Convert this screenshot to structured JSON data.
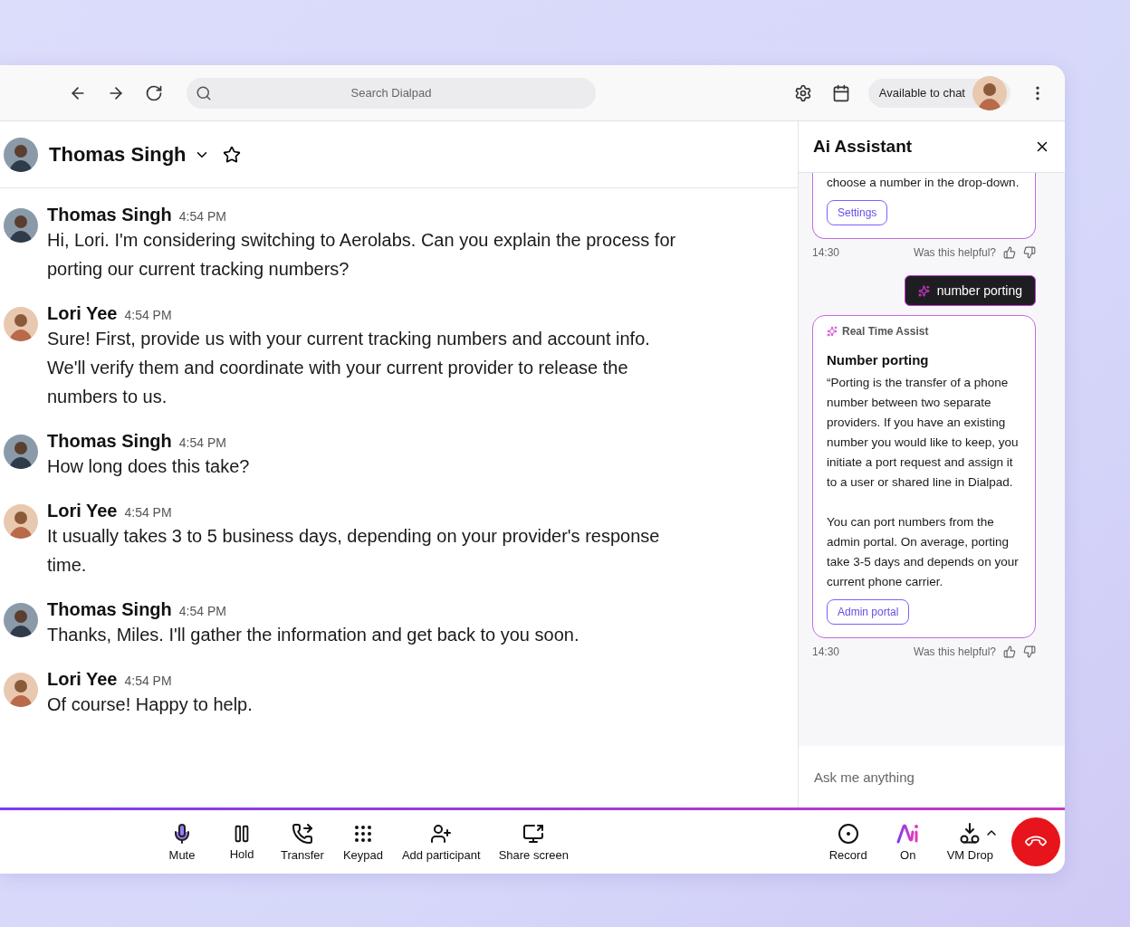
{
  "toolbar": {
    "search": {
      "placeholder": "Search Dialpad"
    },
    "status": "Available to chat"
  },
  "contact": {
    "name": "Thomas Singh"
  },
  "messages": [
    {
      "sender": "Thomas Singh",
      "time": "4:54 PM",
      "text": "Hi, Lori. I'm considering switching to Aerolabs. Can you explain the process for porting our current tracking numbers?"
    },
    {
      "sender": "Lori Yee",
      "time": "4:54 PM",
      "text": "Sure! First, provide us with your current tracking numbers and account info. We'll verify them and coordinate with your current provider to release the numbers to us."
    },
    {
      "sender": "Thomas Singh",
      "time": "4:54 PM",
      "text": "How long does this take?"
    },
    {
      "sender": "Lori Yee",
      "time": "4:54 PM",
      "text": "It usually takes 3 to 5 business days, depending on your provider's response time."
    },
    {
      "sender": "Thomas Singh",
      "time": "4:54 PM",
      "text": "Thanks, Miles. I'll gather the information and get back to you soon."
    },
    {
      "sender": "Lori Yee",
      "time": "4:54 PM",
      "text": "Of course! Happy to help."
    }
  ],
  "assistant": {
    "title": "Ai Assistant",
    "items": [
      {
        "kind": "continued",
        "paragraphs": [
          "choose a number in the drop-down."
        ],
        "button": "Settings",
        "time": "14:30",
        "feedback": "Was this helpful?"
      },
      {
        "kind": "query",
        "text": "number porting"
      },
      {
        "kind": "card",
        "label": "Real Time Assist",
        "heading": "Number porting",
        "paragraphs": [
          "“Porting is the transfer of a phone number between two separate providers. If you have an existing number you would like to keep, you initiate a port request and assign it to a user or shared line in Dialpad.",
          "You can port numbers from the admin portal. On average, porting take 3-5 days and depends on your current phone carrier."
        ],
        "button": "Admin portal",
        "time": "14:30",
        "feedback": "Was this helpful?"
      }
    ],
    "input": {
      "placeholder": "Ask me anything"
    }
  },
  "controls": [
    {
      "kind": "mic",
      "label": "Mute"
    },
    {
      "kind": "pause",
      "label": "Hold"
    },
    {
      "kind": "transfer",
      "label": "Transfer"
    },
    {
      "kind": "keypad",
      "label": "Keypad"
    },
    {
      "kind": "add-user",
      "label": "Add participant"
    },
    {
      "kind": "share",
      "label": "Share screen"
    }
  ],
  "controls_right": [
    {
      "kind": "record",
      "label": "Record"
    },
    {
      "kind": "ai",
      "label": "On"
    },
    {
      "kind": "vm-drop",
      "label": "VM Drop"
    }
  ]
}
